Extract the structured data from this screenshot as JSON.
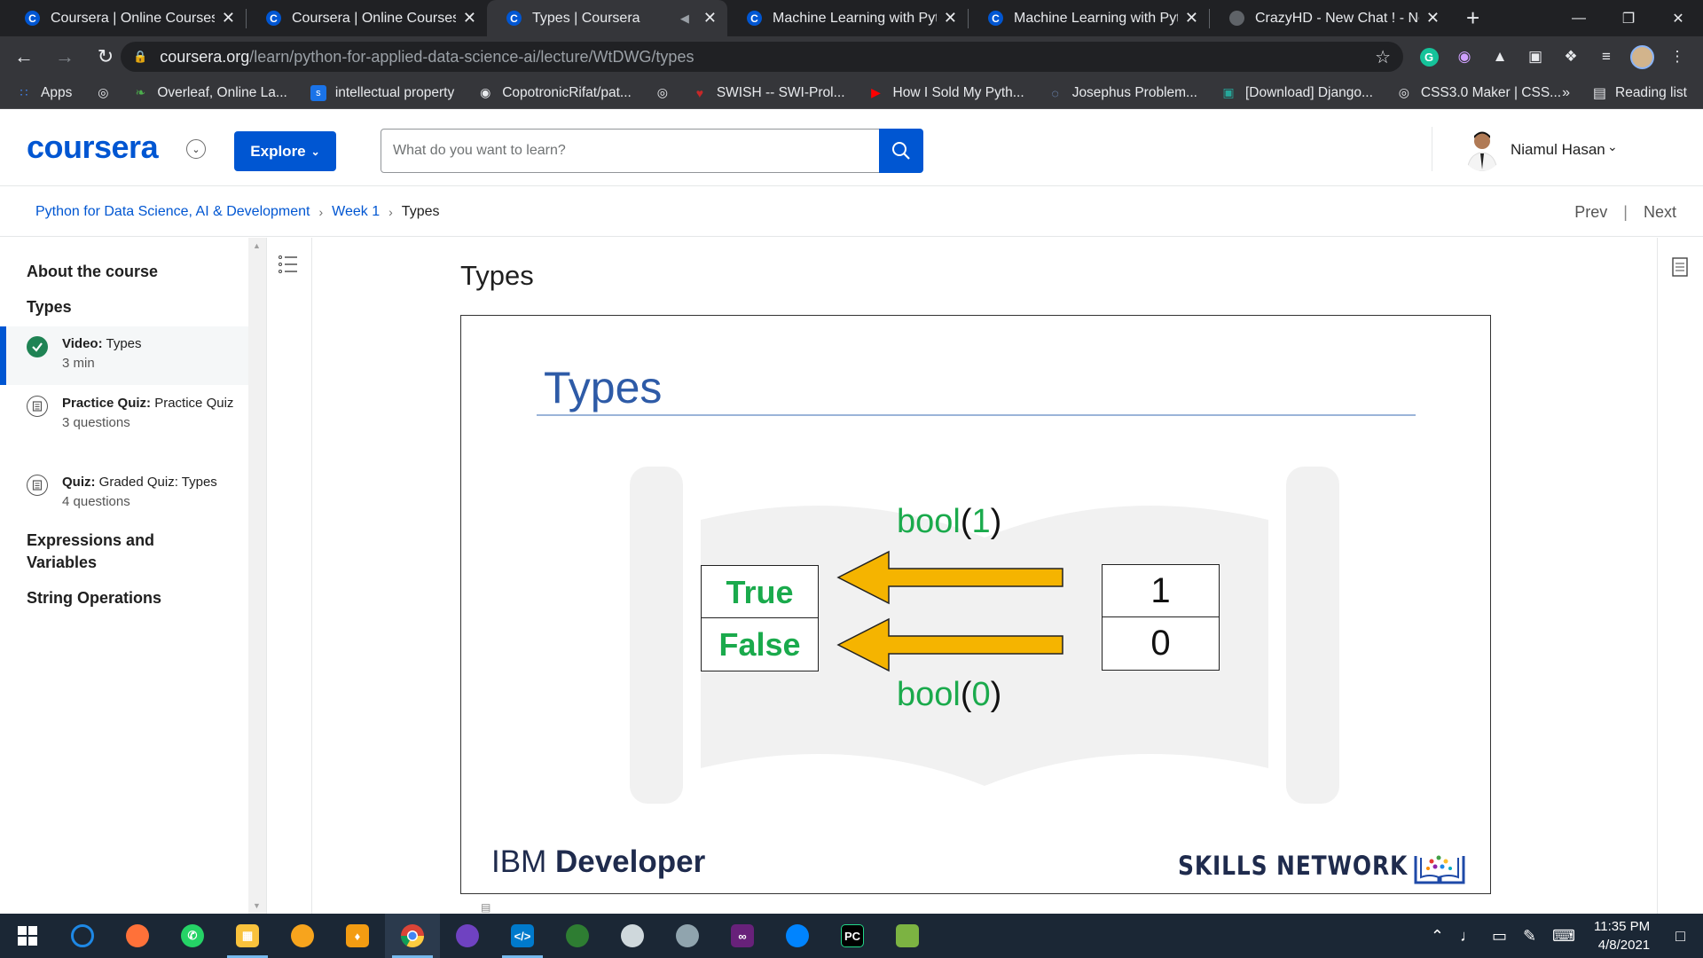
{
  "browser": {
    "tabs": [
      {
        "title": "Coursera | Online Courses &",
        "icon": "coursera-icon",
        "active": false
      },
      {
        "title": "Coursera | Online Courses &",
        "icon": "coursera-icon",
        "active": false
      },
      {
        "title": "Types | Coursera",
        "icon": "coursera-icon",
        "active": true
      },
      {
        "title": "Machine Learning with Pytho",
        "icon": "coursera-icon",
        "active": false
      },
      {
        "title": "Machine Learning with Pytho",
        "icon": "coursera-icon",
        "active": false
      },
      {
        "title": "CrazyHD - New Chat ! - New",
        "icon": "globe-icon",
        "active": false
      }
    ],
    "url_host": "coursera.org",
    "url_path": "/learn/python-for-applied-data-science-ai/lecture/WtDWG/types",
    "bookmarks": [
      {
        "label": "Apps",
        "icon": "apps-grid-icon",
        "color": "#4285f4"
      },
      {
        "label": "",
        "icon": "globe-icon",
        "color": "#e8eaed"
      },
      {
        "label": "Overleaf, Online La...",
        "icon": "overleaf-icon",
        "color": "#4cae4c"
      },
      {
        "label": "intellectual property",
        "icon": "scholar-icon",
        "color": "#1a73e8"
      },
      {
        "label": "CopotronicRifat/pat...",
        "icon": "github-icon",
        "color": "#e8eaed"
      },
      {
        "label": "",
        "icon": "globe-icon",
        "color": "#e8eaed"
      },
      {
        "label": "SWISH -- SWI-Prol...",
        "icon": "swish-icon",
        "color": "#c62828"
      },
      {
        "label": "How I Sold My Pyth...",
        "icon": "youtube-icon",
        "color": "#ff0000"
      },
      {
        "label": "Josephus Problem...",
        "icon": "loading-icon",
        "color": "#8ab4f8"
      },
      {
        "label": "[Download] Django...",
        "icon": "download-site-icon",
        "color": "#26a69a"
      },
      {
        "label": "CSS3.0 Maker | CSS...",
        "icon": "globe-icon",
        "color": "#e8eaed"
      }
    ],
    "more_label": "»",
    "reading_list": "Reading list"
  },
  "header": {
    "logo": "coursera",
    "explore_label": "Explore",
    "search_placeholder": "What do you want to learn?",
    "user_name": "Niamul Hasan"
  },
  "breadcrumb": {
    "course": "Python for Data Science, AI & Development",
    "week": "Week 1",
    "current": "Types",
    "prev": "Prev",
    "next": "Next"
  },
  "sidebar": {
    "about": "About the course",
    "section": "Types",
    "items": [
      {
        "kind": "Video:",
        "name": "Types",
        "sub": "3 min",
        "done": true
      },
      {
        "kind": "Practice Quiz:",
        "name": "Practice Quiz",
        "sub": "3 questions",
        "done": false
      },
      {
        "kind": "Quiz:",
        "name": "Graded Quiz: Types",
        "sub": "4 questions",
        "done": false
      }
    ],
    "sections_after": [
      "Expressions and Variables",
      "String Operations"
    ]
  },
  "main": {
    "title": "Types",
    "slide": {
      "title": "Types",
      "top_func": "bool",
      "top_arg": "1",
      "bottom_func": "bool",
      "bottom_arg": "0",
      "true_label": "True",
      "false_label": "False",
      "one": "1",
      "zero": "0",
      "ibm_prefix": "IBM",
      "ibm_bold": "Developer",
      "skills": "SKILLS NETWORK"
    }
  },
  "taskbar": {
    "time": "11:35 PM",
    "date": "4/8/2021"
  },
  "colors": {
    "coursera_blue": "#0056d2",
    "slide_green": "#1aaa4c",
    "arrow_yellow": "#f5b400",
    "slide_title_blue": "#2e5ba7"
  }
}
